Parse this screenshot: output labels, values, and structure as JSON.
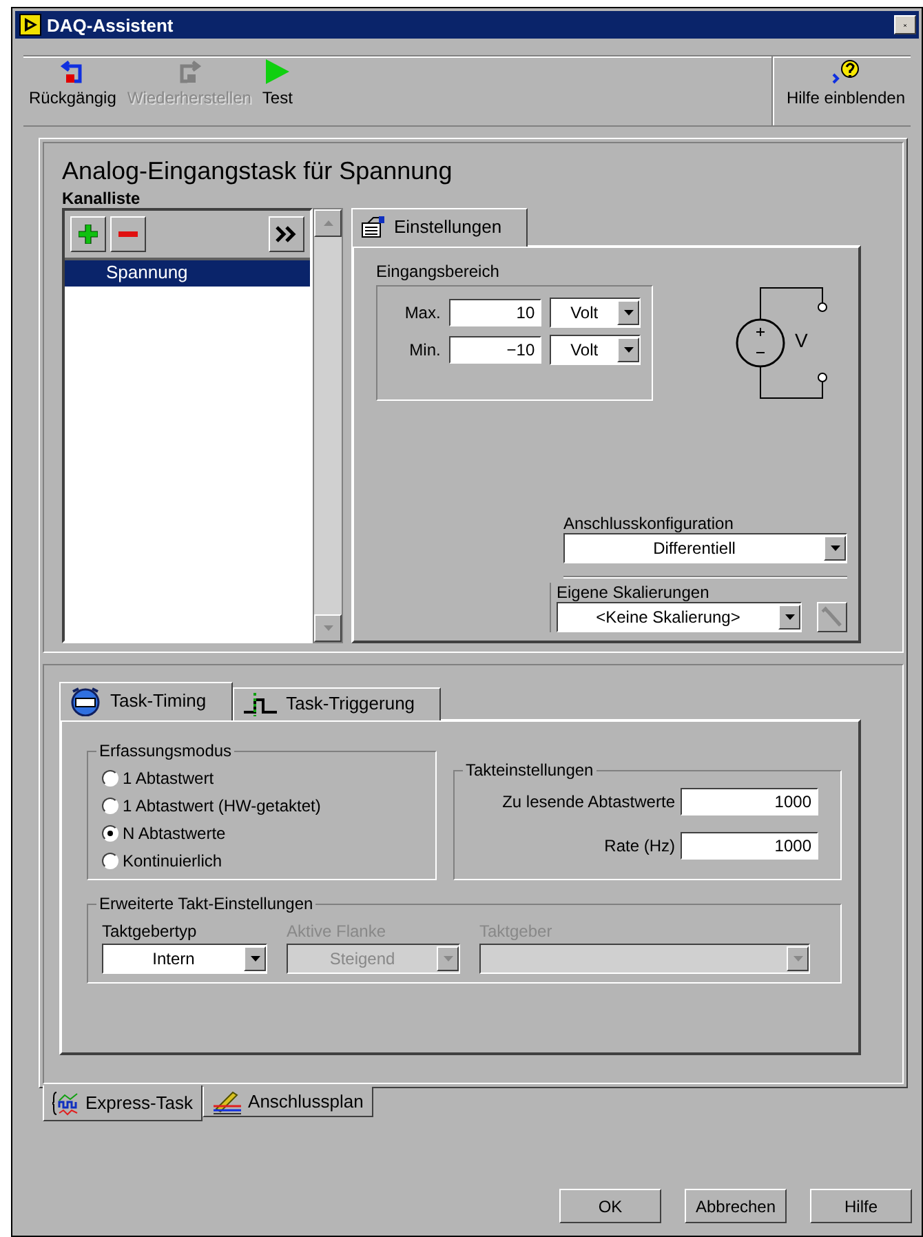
{
  "window": {
    "title": "DAQ-Assistent"
  },
  "toolbar": [
    {
      "kind": "undo",
      "label": "Rückgängig",
      "disabled": false
    },
    {
      "kind": "redo",
      "label": "Wiederherstellen",
      "disabled": true
    },
    {
      "kind": "run",
      "label": "Test",
      "disabled": false
    },
    {
      "kind": "help",
      "label": "Hilfe einblenden",
      "disabled": false
    }
  ],
  "heading": "Analog-Eingangstask für Spannung",
  "channel_list": {
    "label": "Kanalliste",
    "channels": [
      {
        "name": "Spannung",
        "selected": true
      }
    ]
  },
  "settings_tab": {
    "label": "Einstellungen",
    "selected": true
  },
  "input_range": {
    "title": "Eingangsbereich",
    "rows": [
      {
        "label": "Max.",
        "value": "10",
        "unit": "Volt"
      },
      {
        "label": "Min.",
        "value": "−10",
        "unit": "Volt"
      }
    ],
    "circuit_label": "V"
  },
  "connection": {
    "label": "Anschlusskonfiguration",
    "value": "Differentiell"
  },
  "scaling": {
    "label": "Eigene Skalierungen",
    "value": "<Keine Skalierung>"
  },
  "timing_tabs": [
    {
      "kind": "timing",
      "label": "Task-Timing",
      "selected": true
    },
    {
      "kind": "trigger",
      "label": "Task-Triggerung",
      "selected": false
    }
  ],
  "acquisition_mode": {
    "title": "Erfassungsmodus",
    "options": [
      {
        "label": "1 Abtastwert",
        "selected": false
      },
      {
        "label": "1 Abtastwert (HW-getaktet)",
        "selected": false
      },
      {
        "label": "N Abtastwerte",
        "selected": true
      },
      {
        "label": "Kontinuierlich",
        "selected": false
      }
    ]
  },
  "clock_settings": {
    "title": "Takteinstellungen",
    "fields": [
      {
        "label": "Zu lesende Abtastwerte",
        "value": "1000"
      },
      {
        "label": "Rate (Hz)",
        "value": "1000"
      }
    ]
  },
  "advanced_clock": {
    "title": "Erweiterte Takt-Einstellungen",
    "fields": [
      {
        "label": "Taktgebertyp",
        "value": "Intern",
        "disabled": false
      },
      {
        "label": "Aktive Flanke",
        "value": "Steigend",
        "disabled": true
      },
      {
        "label": "Taktgeber",
        "disabled": true
      }
    ]
  },
  "bottom_tabs": [
    {
      "kind": "express",
      "label": "Express-Task",
      "selected": true
    },
    {
      "kind": "wiring",
      "label": "Anschlussplan",
      "selected": false
    }
  ],
  "buttons": [
    "OK",
    "Abbrechen",
    "Hilfe"
  ]
}
